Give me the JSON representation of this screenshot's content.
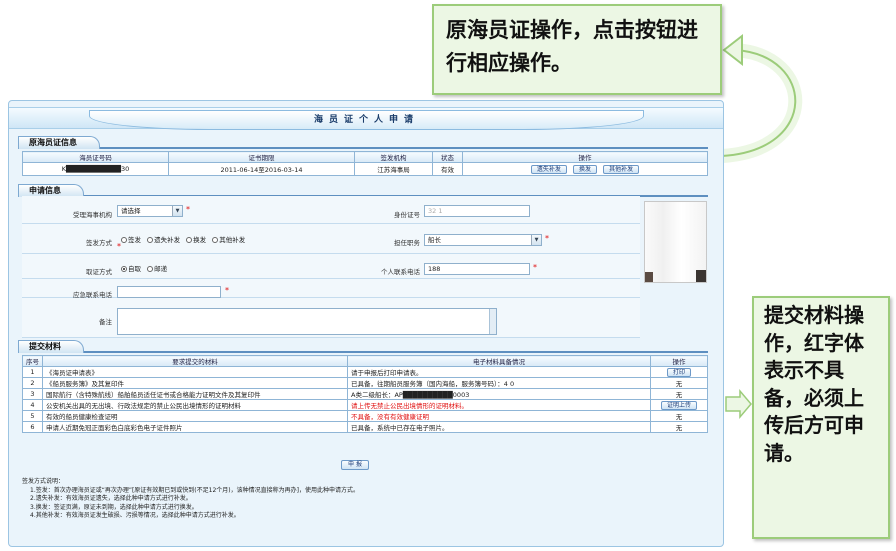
{
  "window": {
    "title": "海员证个人申请"
  },
  "original_info": {
    "section_label": "原海员证信息",
    "headers": [
      "海员证号码",
      "证书期限",
      "签发机构",
      "状态",
      "操作"
    ],
    "row": {
      "cert_no": "K███████████30",
      "validity": "2011-06-14至2016-03-14",
      "issuer": "江苏海事局",
      "status": "有效",
      "buttons": [
        "遗失补发",
        "换发",
        "其他补发"
      ]
    }
  },
  "apply_info": {
    "section_label": "申请信息",
    "agency_label": "受理海事机构",
    "agency_value": "请选择",
    "idcard_label": "身份证号",
    "idcard_value": "32               1",
    "issue_type_label": "签发方式",
    "issue_type_options": [
      "签发",
      "遗失补发",
      "换发",
      "其他补发"
    ],
    "position_label": "担任职务",
    "position_value": "船长",
    "pickup_label": "取证方式",
    "pickup_options": [
      "自取",
      "邮递"
    ],
    "phone_label": "个人联系电话",
    "phone_value": "188",
    "emergency_label": "应急联系电话",
    "emergency_value": "",
    "remark_label": "备注",
    "remark_value": "",
    "required_mark": "*"
  },
  "materials": {
    "section_label": "提交材料",
    "headers": [
      "序号",
      "要求提交的材料",
      "电子材料具备情况",
      "操作"
    ],
    "rows": [
      {
        "no": "1",
        "name": "《海员证申请表》",
        "status": "请于申报后打印申请表。",
        "status_red": false,
        "action": "打印",
        "action_type": "button"
      },
      {
        "no": "2",
        "name": "《船员服务簿》及其复印件",
        "status": "已具备，往期船员服务簿（国内海船，服务簿号码）：4                        0",
        "status_red": false,
        "action": "无",
        "action_type": "text"
      },
      {
        "no": "3",
        "name": "国际航行（含特殊航线）船舶船员适任证书或合格能力证明文件及其复印件",
        "status": "A类二级船长：AP██████████0003",
        "status_red": false,
        "action": "无",
        "action_type": "text"
      },
      {
        "no": "4",
        "name": "公安机关出具的无出境、行政法规定的禁止公民出境情形的证明材料",
        "status": "请上传无禁止公民出境情形的证明材料。",
        "status_red": true,
        "action": "证明上传",
        "action_type": "button"
      },
      {
        "no": "5",
        "name": "有效的船员健康检查证明",
        "status": "不具备，没有有效健康证明",
        "status_red": true,
        "action": "无",
        "action_type": "text"
      },
      {
        "no": "6",
        "name": "申请人近期免冠正面彩色白底彩色电子证件照片",
        "status": "已具备，系统中已存在电子照片。",
        "status_red": false,
        "action": "无",
        "action_type": "text"
      }
    ],
    "submit_label": "申 报"
  },
  "notes": {
    "title": "签发方式说明：",
    "lines": [
      "1.签发：首次办理海员证或“再次办理”[原证有效期已到或快到(不足12个月)，该种情况直接称为再办]，使用此种申请方式。",
      "2.遗失补发：有效海员证遗失，选择此种申请方式进行补发。",
      "3.换发：签证页满，原证未到期，选择此种申请方式进行换发。",
      "4.其他补发：有效海员证发生破损、污损等情况，选择此种申请方式进行补发。"
    ]
  },
  "callouts": {
    "top": "原海员证操作，点击按钮进行相应操作。",
    "right": "提交材料操作，红字体表示不具备，必须上传后方可申请。"
  },
  "colors": {
    "accent": "#5e8fc0",
    "warning": "#e01010",
    "callout_bg": "#ecf7e4",
    "callout_border": "#9ccc7a"
  }
}
